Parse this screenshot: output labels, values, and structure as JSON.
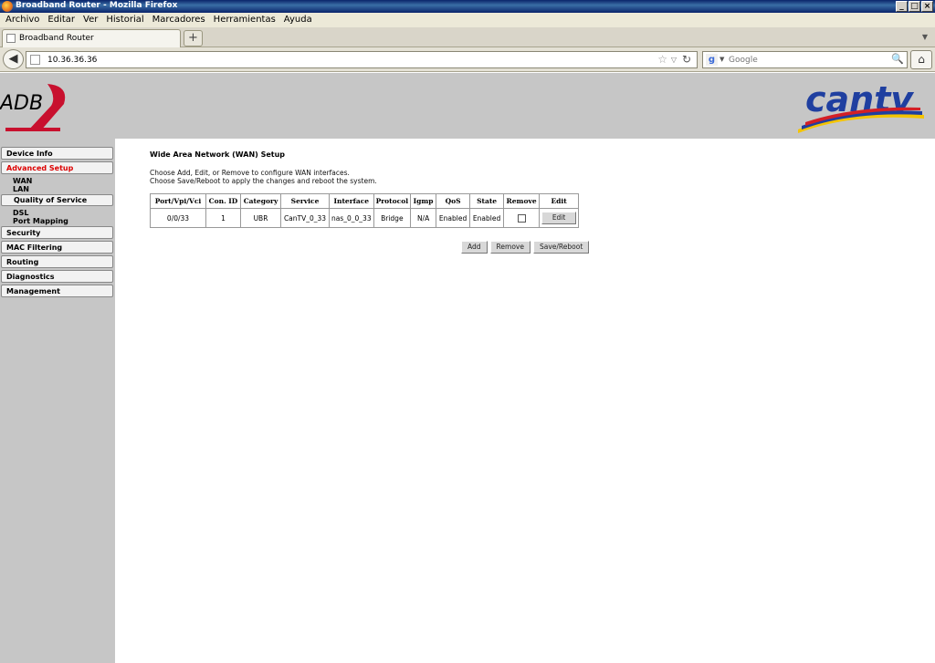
{
  "window": {
    "title": "Broadband Router - Mozilla Firefox",
    "controls": {
      "minimize": "_",
      "maximize": "□",
      "close": "×"
    }
  },
  "menubar": {
    "items": [
      "Archivo",
      "Editar",
      "Ver",
      "Historial",
      "Marcadores",
      "Herramientas",
      "Ayuda"
    ]
  },
  "tabs": [
    {
      "label": "Broadband Router"
    }
  ],
  "newtab_label": "+",
  "navbar": {
    "url": "10.36.36.36",
    "search_placeholder": "Google"
  },
  "brand": {
    "left": "ADB",
    "right": "cantv"
  },
  "sidebar": {
    "items": [
      {
        "label": "Device Info"
      },
      {
        "label": "Advanced Setup",
        "active": true
      },
      {
        "label": "Security"
      },
      {
        "label": "MAC Filtering"
      },
      {
        "label": "Routing"
      },
      {
        "label": "Diagnostics"
      },
      {
        "label": "Management"
      }
    ],
    "sub_items": [
      "WAN",
      "LAN",
      "Quality of Service",
      "DSL",
      "Port Mapping"
    ]
  },
  "main": {
    "title": "Wide Area Network (WAN) Setup",
    "desc_line1": "Choose Add, Edit, or Remove to configure WAN interfaces.",
    "desc_line2": "Choose Save/Reboot to apply the changes and reboot the system.",
    "table": {
      "headers": [
        "Port/Vpi/Vci",
        "Con. ID",
        "Category",
        "Service",
        "Interface",
        "Protocol",
        "Igmp",
        "QoS",
        "State",
        "Remove",
        "Edit"
      ],
      "rows": [
        [
          "0/0/33",
          "1",
          "UBR",
          "CanTV_0_33",
          "nas_0_0_33",
          "Bridge",
          "N/A",
          "Enabled",
          "Enabled",
          "",
          "Edit"
        ]
      ]
    },
    "buttons": {
      "add": "Add",
      "remove": "Remove",
      "save_reboot": "Save/Reboot"
    }
  },
  "colors": {
    "active_nav": "#dd0000",
    "banner_bg": "#c6c6c6",
    "adb_red": "#c8102e"
  }
}
